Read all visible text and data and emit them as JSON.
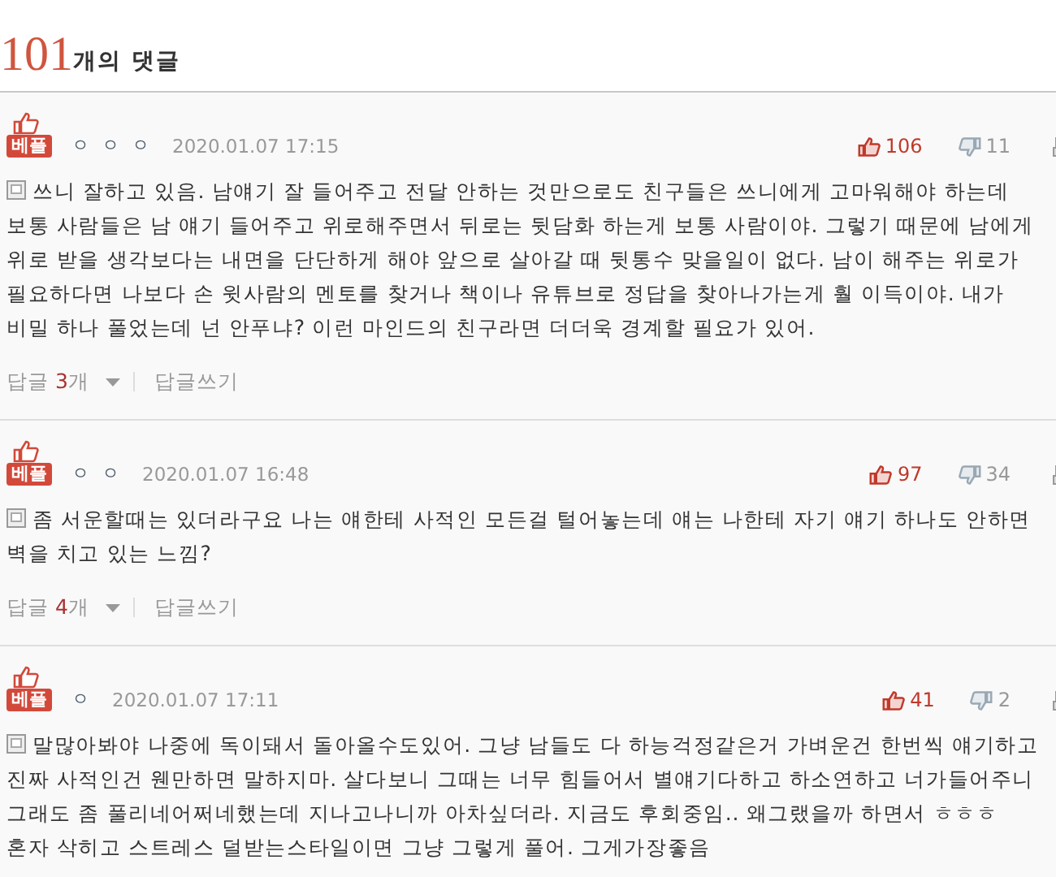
{
  "header": {
    "count": "101",
    "label": "개의 댓글"
  },
  "comments": [
    {
      "badge": "베플",
      "user": "ㅇ ㅇ ㅇ",
      "date": "2020.01.07 17:15",
      "likes": "106",
      "dislikes": "11",
      "text": "쓰니 잘하고 있음. 남얘기 잘 들어주고 전달 안하는 것만으로도 친구들은 쓰니에게 고마워해야 하는데 보통 사람들은 남 얘기 들어주고 위로해주면서 뒤로는 뒷담화 하는게 보통 사람이야. 그렇기 때문에 남에게 위로 받을 생각보다는 내면을 단단하게 해야 앞으로 살아갈 때 뒷통수 맞을일이 없다. 남이 해주는 위로가 필요하다면 나보다 손 윗사람의 멘토를 찾거나 책이나 유튜브로 정답을 찾아나가는게 훨 이득이야. 내가 비밀 하나 풀었는데 넌 안푸냐? 이런 마인드의 친구라면 더더욱 경계할 필요가 있어.",
      "replies": {
        "label": "답글",
        "count": "3",
        "unit": "개"
      },
      "write": "답글쓰기"
    },
    {
      "badge": "베플",
      "user": "ㅇ ㅇ",
      "date": "2020.01.07 16:48",
      "likes": "97",
      "dislikes": "34",
      "text": "좀 서운할때는 있더라구요 나는 얘한테 사적인 모든걸 털어놓는데 얘는 나한테 자기 얘기 하나도 안하면 벽을 치고 있는 느낌?",
      "replies": {
        "label": "답글",
        "count": "4",
        "unit": "개"
      },
      "write": "답글쓰기"
    },
    {
      "badge": "베플",
      "user": "ㅇ",
      "date": "2020.01.07 17:11",
      "likes": "41",
      "dislikes": "2",
      "text": "말많아봐야 나중에 독이돼서 돌아올수도있어. 그냥 남들도 다 하능걱정같은거 가벼운건 한번씩 얘기하고 진짜 사적인건 웬만하면 말하지마. 살다보니 그때는 너무 힘들어서 별얘기다하고 하소연하고 너가들어주니 그래도 좀 풀리네어쩌네했는데 지나고나니까 아차싶더라. 지금도 후회중임.. 왜그랬을까 하면서 ㅎㅎㅎ 혼자 삭히고 스트레스 덜받는스타일이면 그냥 그렇게 풀어. 그게가장좋음"
    }
  ]
}
